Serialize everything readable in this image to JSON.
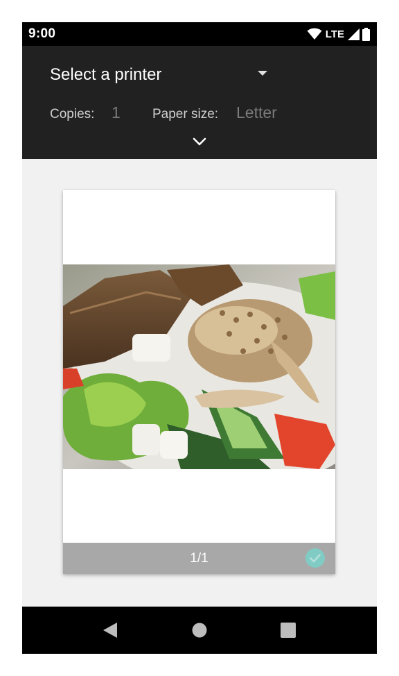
{
  "status_bar": {
    "time": "9:00",
    "network": "LTE",
    "icons": [
      "wifi-icon",
      "signal-icon",
      "battery-icon"
    ]
  },
  "header": {
    "printer_select": "Select a printer",
    "copies_label": "Copies:",
    "copies_value": "1",
    "paper_size_label": "Paper size:",
    "paper_size_value": "Letter",
    "expand_icon": "chevron-down-icon"
  },
  "preview": {
    "page_indicator": "1/1",
    "selected_icon": "check-circle-icon",
    "check_color": "#80cbc4"
  },
  "nav_bar": {
    "icons": [
      "back-icon",
      "home-icon",
      "recents-icon"
    ]
  },
  "colors": {
    "header_bg": "#212121",
    "preview_bg": "#f1f1f1",
    "footer_bg": "#a8a8a8"
  }
}
